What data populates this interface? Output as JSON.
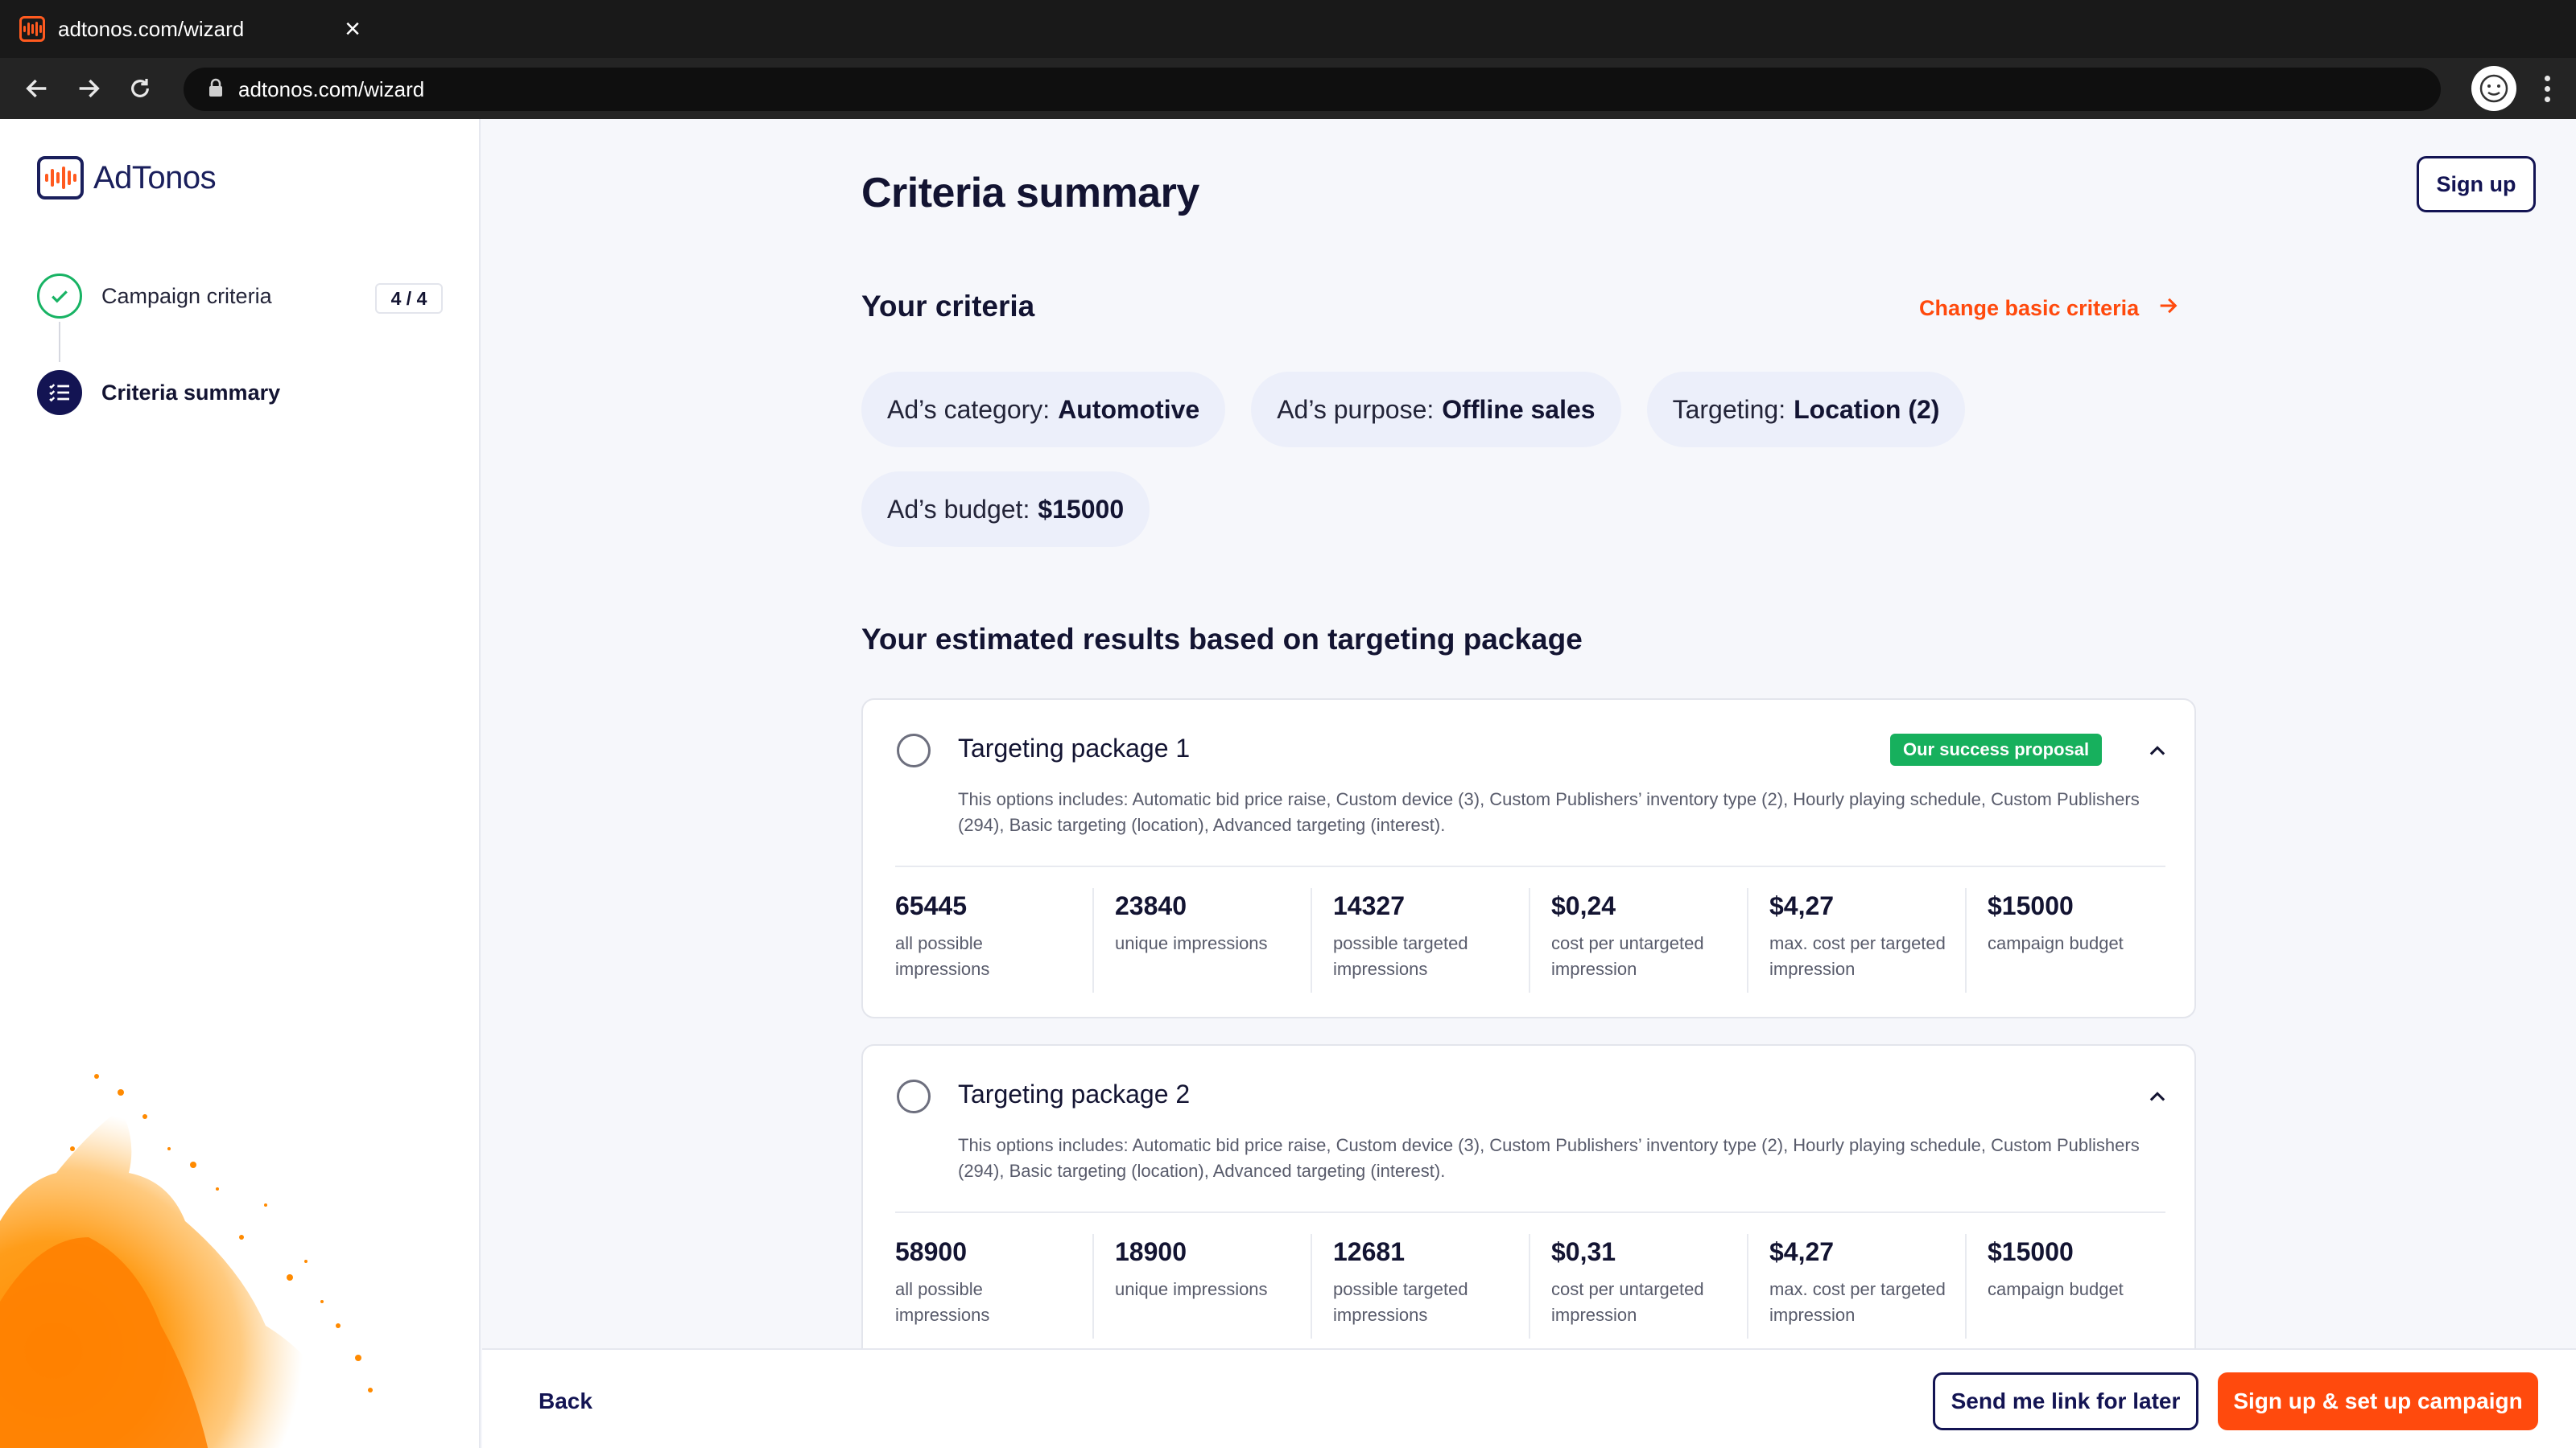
{
  "browser": {
    "tab_title": "adtonos.com/wizard",
    "tab_close": "×",
    "url": "adtonos.com/wizard"
  },
  "sidebar": {
    "logo_text": "AdTonos",
    "steps": [
      {
        "label": "Campaign criteria",
        "count": "4 / 4",
        "state": "done"
      },
      {
        "label": "Criteria summary",
        "state": "active"
      }
    ]
  },
  "header": {
    "signup_label": "Sign up"
  },
  "main": {
    "title": "Criteria summary",
    "your_criteria_title": "Your criteria",
    "change_link": "Change basic criteria",
    "chips": [
      {
        "label": "Ad’s category:",
        "value": "Automotive"
      },
      {
        "label": "Ad’s purpose:",
        "value": "Offline sales"
      },
      {
        "label": "Targeting:",
        "value": "Location (2)"
      },
      {
        "label": "Ad’s budget:",
        "value": "$15000"
      }
    ],
    "results_title": "Your estimated results based on targeting package",
    "packages": [
      {
        "title": "Targeting package 1",
        "badge": "Our success proposal",
        "description": "This options includes: Automatic bid price raise, Custom device (3), Custom Publishers’ inventory type (2), Hourly playing schedule, Custom Publishers (294), Basic targeting (location), Advanced targeting (interest).",
        "stats": [
          {
            "value": "65445",
            "label": "all possible impressions"
          },
          {
            "value": "23840",
            "label": "unique impressions"
          },
          {
            "value": "14327",
            "label": "possible targeted impressions"
          },
          {
            "value": "$0,24",
            "label": "cost per untargeted impression"
          },
          {
            "value": "$4,27",
            "label": "max. cost per targeted impression"
          },
          {
            "value": "$15000",
            "label": "campaign budget"
          }
        ]
      },
      {
        "title": "Targeting package 2",
        "description": "This options includes: Automatic bid price raise, Custom device (3), Custom Publishers’ inventory type (2), Hourly playing schedule, Custom Publishers (294), Basic targeting (location), Advanced targeting (interest).",
        "stats": [
          {
            "value": "58900",
            "label": "all possible impressions"
          },
          {
            "value": "18900",
            "label": "unique impressions"
          },
          {
            "value": "12681",
            "label": "possible targeted impressions"
          },
          {
            "value": "$0,31",
            "label": "cost per untargeted impression"
          },
          {
            "value": "$4,27",
            "label": "max. cost per targeted impression"
          },
          {
            "value": "$15000",
            "label": "campaign budget"
          }
        ]
      }
    ]
  },
  "footer": {
    "back_label": "Back",
    "later_label": "Send me link for later",
    "primary_label": "Sign up & set up campaign"
  },
  "colors": {
    "accent_orange": "#ff4a0d",
    "navy": "#131453",
    "success_green": "#17b05d",
    "chip_bg": "#eceffa"
  }
}
